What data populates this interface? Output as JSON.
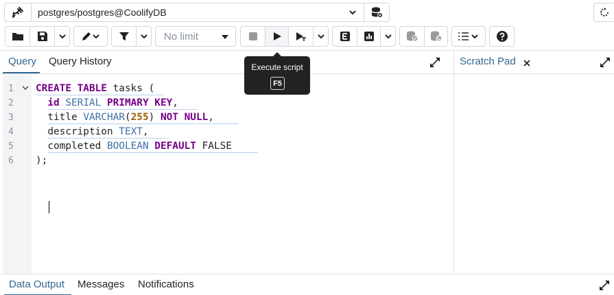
{
  "connection": {
    "label": "postgres/postgres@CoolifyDB",
    "icon": "plug-icon",
    "db_icon": "database-icon",
    "refresh_icon": "refresh-icon"
  },
  "toolbar": {
    "limit_label": "No limit",
    "icons": [
      "folder-icon",
      "save-icon",
      "edit-icon",
      "filter-icon",
      "stop-icon",
      "execute-icon",
      "explain-icon",
      "explain-analyze-icon",
      "chart-icon",
      "commit-icon",
      "rollback-icon",
      "macros-icon",
      "help-icon"
    ]
  },
  "tooltip": {
    "text": "Execute script",
    "shortcut": "F5"
  },
  "query_panel": {
    "tabs": [
      {
        "label": "Query",
        "active": true
      },
      {
        "label": "Query History",
        "active": false
      }
    ]
  },
  "scratch_panel": {
    "tab_label": "Scratch Pad",
    "close_icon": "close-icon"
  },
  "editor": {
    "line_numbers": [
      "1",
      "2",
      "3",
      "4",
      "5",
      "6"
    ],
    "lines": [
      [
        {
          "t": "CREATE TABLE",
          "c": "kw"
        },
        {
          "t": " tasks (",
          "c": ""
        }
      ],
      [
        {
          "t": "  ",
          "c": ""
        },
        {
          "t": "id",
          "c": "kw"
        },
        {
          "t": " ",
          "c": ""
        },
        {
          "t": "SERIAL",
          "c": "ty"
        },
        {
          "t": " ",
          "c": ""
        },
        {
          "t": "PRIMARY KEY",
          "c": "kw"
        },
        {
          "t": ",",
          "c": ""
        }
      ],
      [
        {
          "t": "  title ",
          "c": ""
        },
        {
          "t": "VARCHAR",
          "c": "ty"
        },
        {
          "t": "(",
          "c": ""
        },
        {
          "t": "255",
          "c": "num"
        },
        {
          "t": ") ",
          "c": ""
        },
        {
          "t": "NOT NULL",
          "c": "kw"
        },
        {
          "t": ",",
          "c": ""
        }
      ],
      [
        {
          "t": "  description ",
          "c": ""
        },
        {
          "t": "TEXT",
          "c": "ty"
        },
        {
          "t": ",",
          "c": ""
        }
      ],
      [
        {
          "t": "  completed ",
          "c": ""
        },
        {
          "t": "BOOLEAN",
          "c": "ty"
        },
        {
          "t": " ",
          "c": ""
        },
        {
          "t": "DEFAULT",
          "c": "kw"
        },
        {
          "t": " FALSE",
          "c": ""
        }
      ],
      [
        {
          "t": ");",
          "c": ""
        }
      ]
    ]
  },
  "output_panel": {
    "tabs": [
      {
        "label": "Data Output",
        "active": true
      },
      {
        "label": "Messages",
        "active": false
      },
      {
        "label": "Notifications",
        "active": false
      }
    ]
  },
  "colors": {
    "accent": "#326690",
    "keyword": "#770088",
    "type": "#3d6ea6",
    "number": "#a15d00"
  }
}
